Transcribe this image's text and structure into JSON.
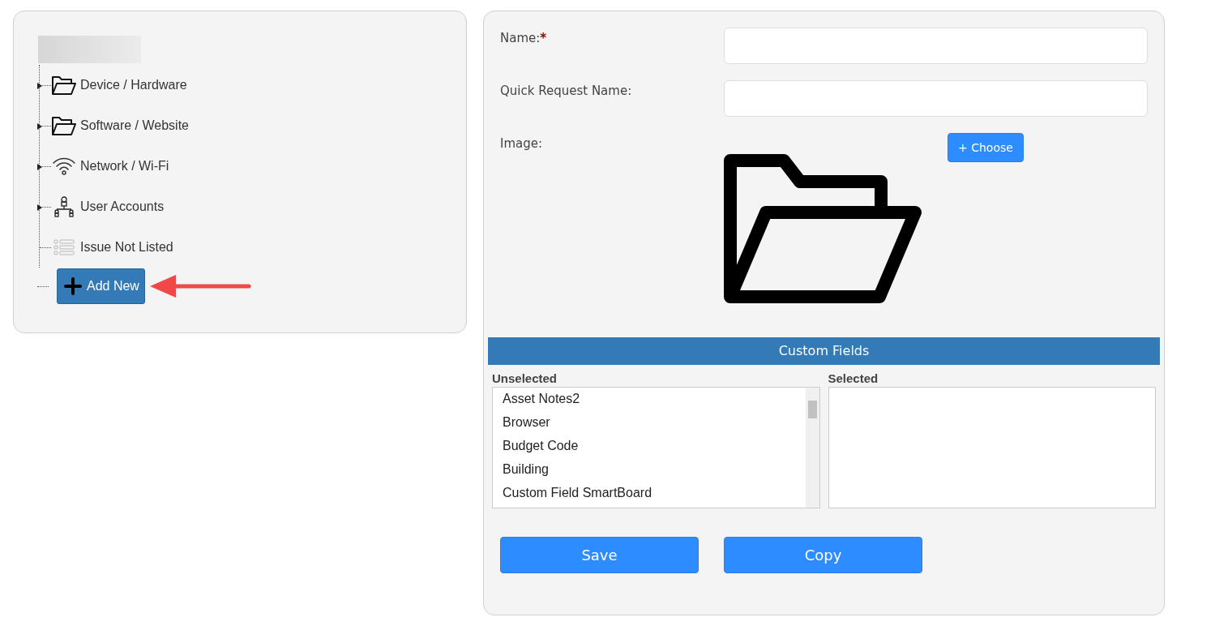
{
  "tree": {
    "items": [
      {
        "label": "Device / Hardware",
        "kind": "folder",
        "expandable": true
      },
      {
        "label": "Software / Website",
        "kind": "folder",
        "expandable": true
      },
      {
        "label": "Network / Wi-Fi",
        "kind": "wifi",
        "expandable": true
      },
      {
        "label": "User Accounts",
        "kind": "users",
        "expandable": true
      },
      {
        "label": "Issue Not Listed",
        "kind": "list",
        "expandable": false
      }
    ],
    "add_button": "Add New"
  },
  "form": {
    "name_label": "Name:",
    "required_mark": "*",
    "quick_label": "Quick Request Name:",
    "image_label": "Image:",
    "choose_button": "+ Choose",
    "custom_fields": {
      "title": "Custom Fields",
      "unselected_label": "Unselected",
      "selected_label": "Selected",
      "unselected": [
        "Asset Notes2",
        "Browser",
        "Budget Code",
        "Building",
        "Custom Field SmartBoard"
      ]
    },
    "buttons": [
      "Save",
      "Copy"
    ]
  }
}
